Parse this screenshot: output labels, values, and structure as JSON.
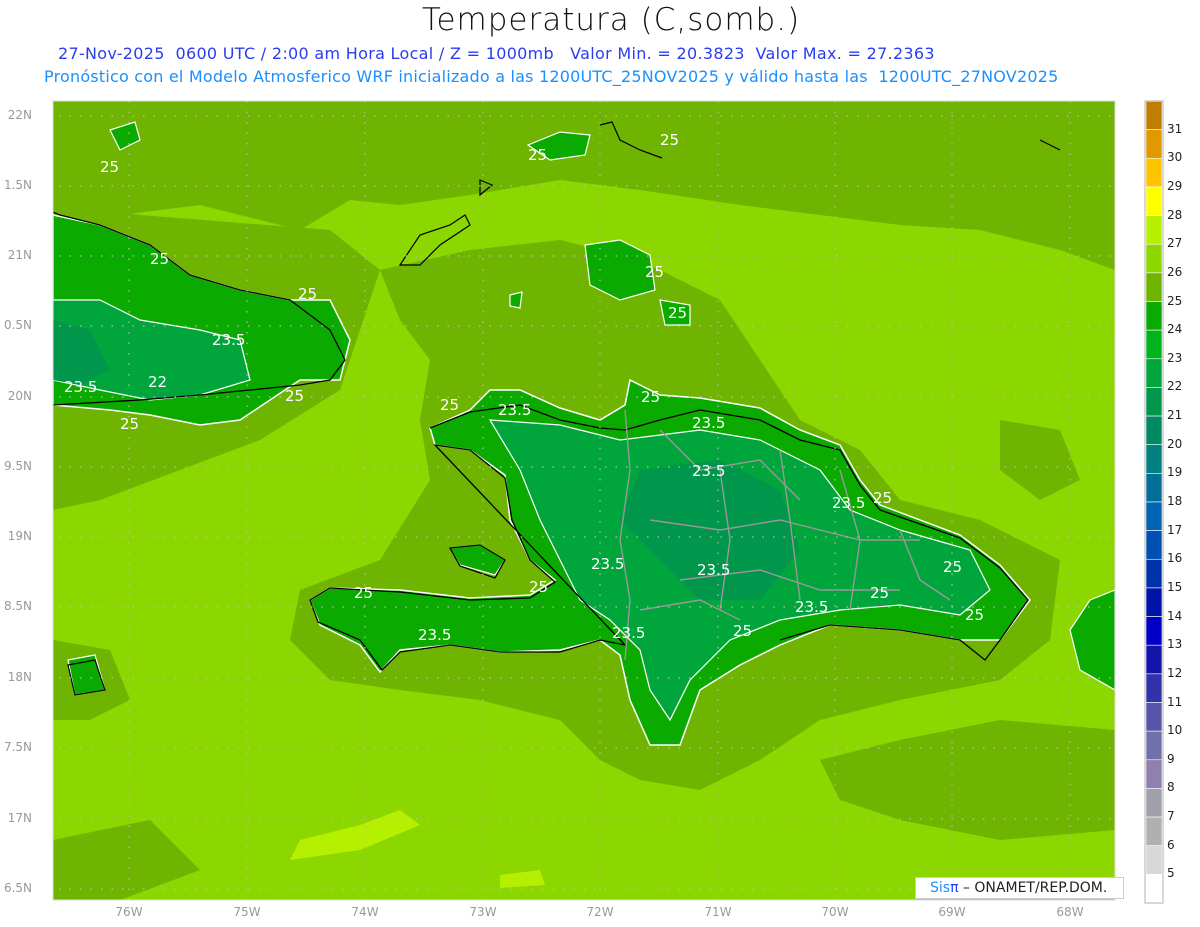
{
  "header": {
    "title": "Temperatura (C,somb.)",
    "line1": "27-Nov-2025  0600 UTC / 2:00 am Hora Local / Z = 1000mb   Valor Min. = 20.3823  Valor Max. = 27.2363",
    "line2": "Pronóstico con el Modelo Atmosferico WRF inicializado a las 1200UTC_25NOV2025 y válido hasta las  1200UTC_27NOV2025"
  },
  "axes": {
    "lat_labels": [
      "22N",
      "1.5N",
      "21N",
      "0.5N",
      "20N",
      "9.5N",
      "19N",
      "8.5N",
      "18N",
      "7.5N",
      "17N",
      "6.5N"
    ],
    "lon_labels": [
      "76W",
      "75W",
      "74W",
      "73W",
      "72W",
      "71W",
      "70W",
      "69W",
      "68W"
    ]
  },
  "colorbar": {
    "labels": [
      "31",
      "30",
      "29",
      "28",
      "27",
      "26",
      "25",
      "24",
      "23",
      "22",
      "21",
      "20",
      "19",
      "18",
      "17",
      "16",
      "15",
      "14",
      "13",
      "12",
      "11",
      "10",
      "9",
      "8",
      "7",
      "6",
      "5"
    ],
    "colors": [
      "#c07e00",
      "#e09a00",
      "#ffc400",
      "#ffff00",
      "#b4f000",
      "#8cd700",
      "#6eb400",
      "#0aaa00",
      "#00b41e",
      "#00a53c",
      "#00964b",
      "#008a64",
      "#008080",
      "#006e96",
      "#0064b4",
      "#0050b4",
      "#0032aa",
      "#0014aa",
      "#0000c8",
      "#1414aa",
      "#3232aa",
      "#5555aa",
      "#7070aa",
      "#9080b0",
      "#a0a0aa",
      "#b0b0b0",
      "#d8d8d8",
      "#ffffff"
    ]
  },
  "map": {
    "background_color": "#8cd700",
    "contour_labels": [
      "25",
      "25",
      "25",
      "25",
      "25",
      "23.5",
      "22",
      "23.5",
      "25",
      "25",
      "25",
      "25",
      "23.5",
      "25",
      "23.5",
      "23.5",
      "23.5",
      "25",
      "23.5",
      "25",
      "25",
      "23.5",
      "23.5",
      "25",
      "25",
      "25",
      "23.5",
      "23.5",
      "25",
      "25"
    ]
  },
  "credit": {
    "sis": "Sis",
    "pi": "π",
    "org": " – ONAMET/REP.DOM."
  }
}
